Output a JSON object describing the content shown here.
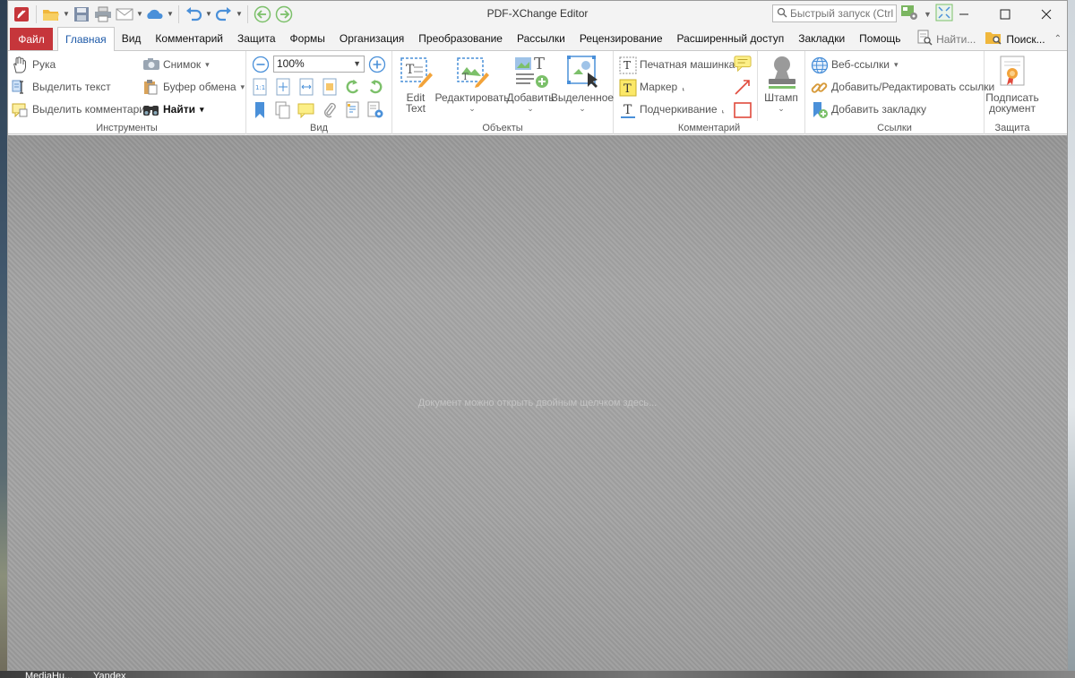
{
  "app": {
    "title": "PDF-XChange Editor",
    "quick_launch_placeholder": "Быстрый запуск (Ctrl..."
  },
  "colors": {
    "file_tab": "#c6363b",
    "active_tab_text": "#1e5aa8",
    "doc_background": "#a1a1a1",
    "accent_blue": "#4a90d9"
  },
  "menu": {
    "file": "Файл",
    "tabs": [
      "Главная",
      "Вид",
      "Комментарий",
      "Защита",
      "Формы",
      "Организация",
      "Преобразование",
      "Рассылки",
      "Рецензирование",
      "Расширенный доступ",
      "Закладки",
      "Помощь"
    ],
    "find": "Найти...",
    "search": "Поиск..."
  },
  "ribbon": {
    "tools": {
      "label": "Инструменты",
      "hand": "Рука",
      "select_text": "Выделить текст",
      "select_comments": "Выделить комментарии",
      "snapshot": "Снимок",
      "clipboard": "Буфер обмена",
      "find": "Найти"
    },
    "view": {
      "label": "Вид",
      "zoom": "100%"
    },
    "objects": {
      "label": "Объекты",
      "edit_text_line1": "Edit",
      "edit_text_line2": "Text",
      "edit": "Редактировать",
      "add": "Добавить",
      "selected": "Выделенное"
    },
    "comment": {
      "label": "Комментарий",
      "typewriter": "Печатная машинка",
      "marker": "Маркер",
      "underline": "Подчеркивание",
      "stamp": "Штамп"
    },
    "links": {
      "label": "Ссылки",
      "web_links": "Веб-ссылки",
      "add_edit_links": "Добавить/Редактировать ссылки",
      "add_bookmark": "Добавить закладку"
    },
    "protect": {
      "label": "Защита",
      "sign_line1": "Подписать",
      "sign_line2": "документ"
    }
  },
  "document": {
    "hint": "Документ можно открыть двойным щелчком здесь..."
  },
  "desktop": {
    "taskbar_items": [
      "MediaHu...",
      "Yandex"
    ]
  }
}
